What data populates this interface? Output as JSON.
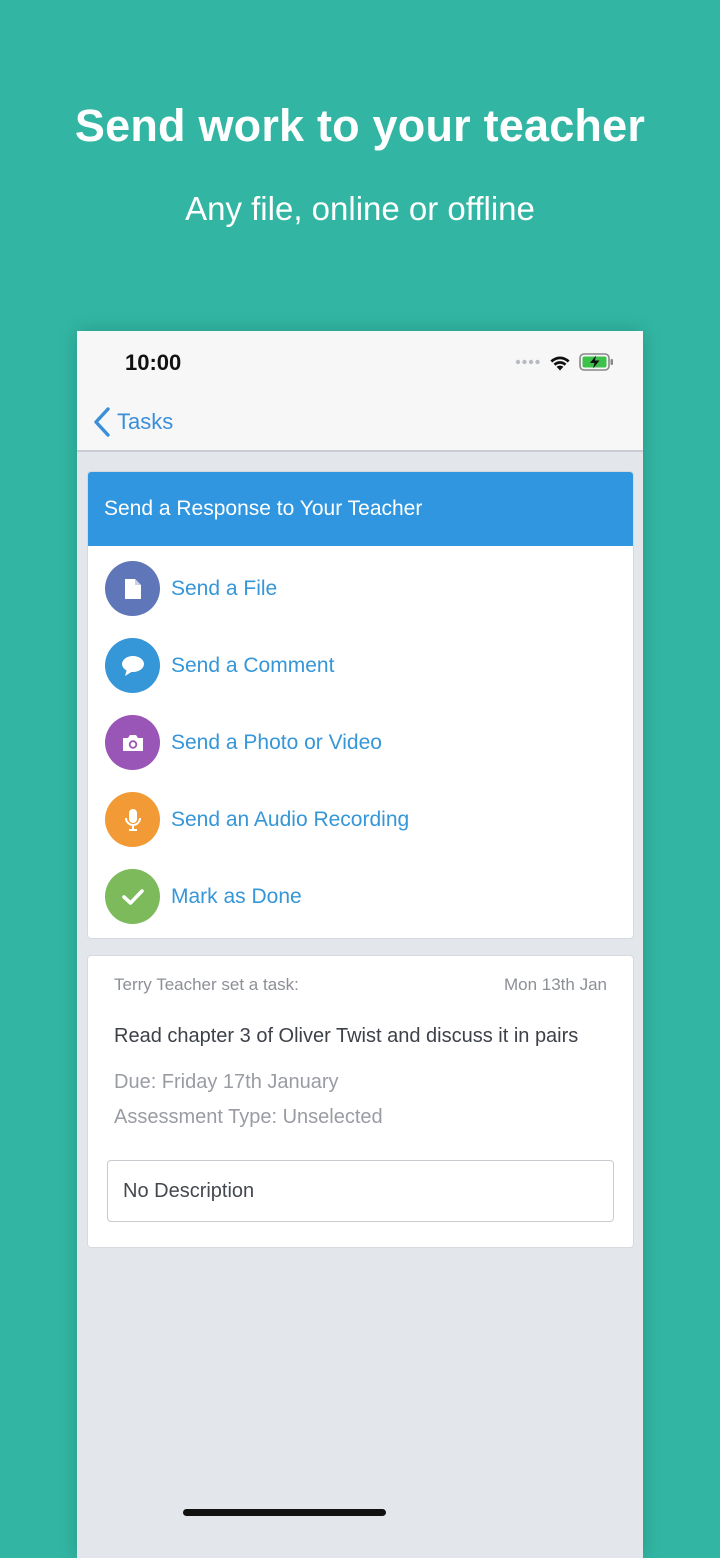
{
  "hero": {
    "title": "Send work to your teacher",
    "subtitle": "Any file, online or offline"
  },
  "status_bar": {
    "time": "10:00",
    "icons": [
      "signal-dots-icon",
      "wifi-icon",
      "battery-charging-icon"
    ]
  },
  "nav": {
    "back_label": "Tasks"
  },
  "response_card": {
    "header": "Send a Response to Your Teacher",
    "actions": [
      {
        "label": "Send a File",
        "icon": "file-icon",
        "color": "#5f77b8"
      },
      {
        "label": "Send a Comment",
        "icon": "comment-icon",
        "color": "#3596d8"
      },
      {
        "label": "Send a Photo or Video",
        "icon": "camera-icon",
        "color": "#9a56b6"
      },
      {
        "label": "Send an Audio Recording",
        "icon": "microphone-icon",
        "color": "#f29a35"
      },
      {
        "label": "Mark as Done",
        "icon": "check-icon",
        "color": "#7cba5b"
      }
    ]
  },
  "task": {
    "setter": "Terry Teacher set a task:",
    "date": "Mon 13th Jan",
    "title": "Read chapter 3 of Oliver Twist and discuss it in pairs",
    "due": "Due: Friday 17th January",
    "assessment": "Assessment Type: Unselected",
    "description": "No Description"
  },
  "colors": {
    "background": "#32b6a3",
    "header_blue": "#3096df",
    "link_blue": "#3596d8"
  }
}
